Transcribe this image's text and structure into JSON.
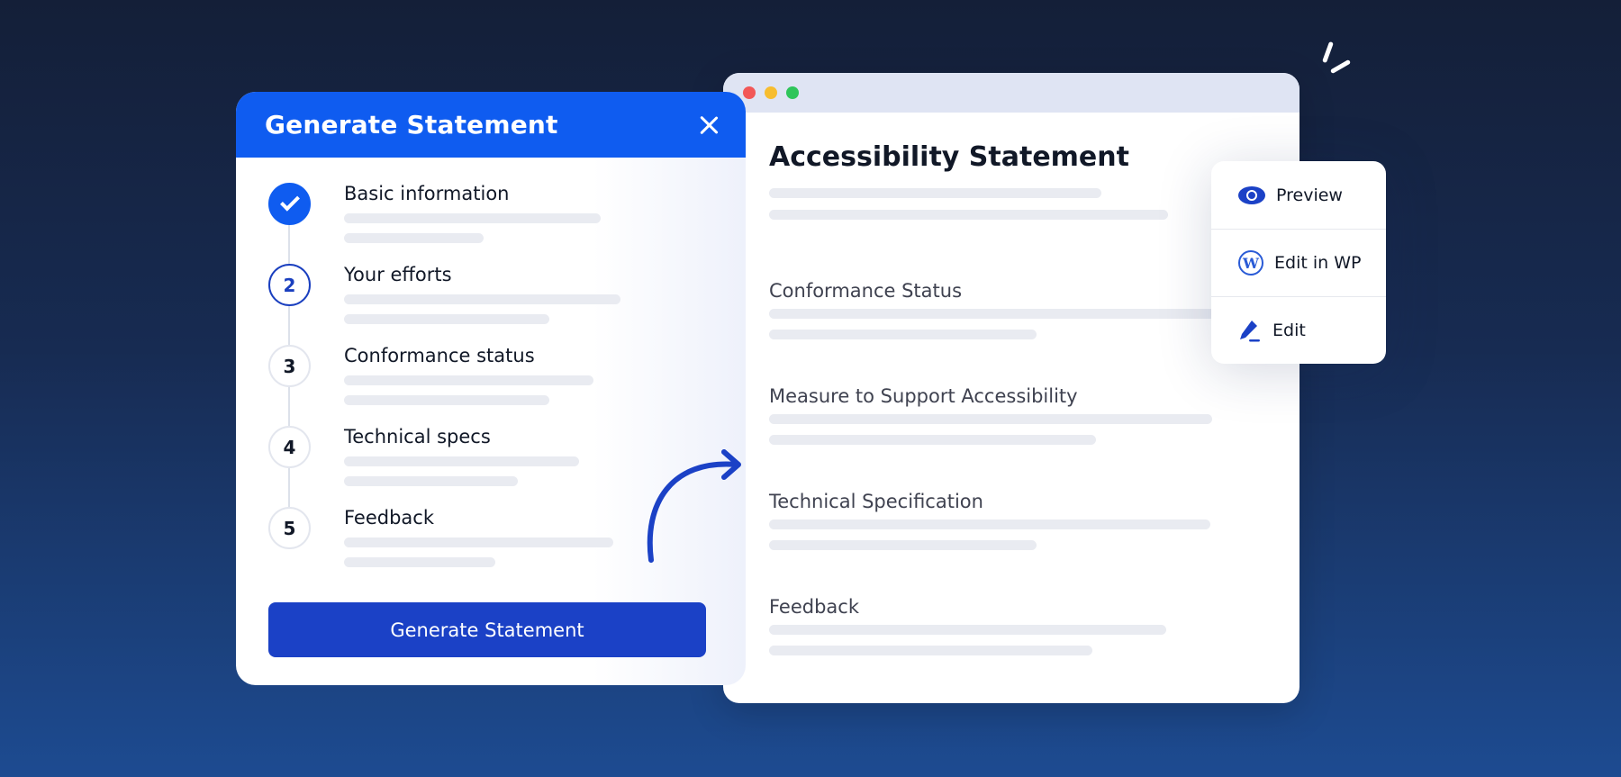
{
  "dialog": {
    "title": "Generate Statement",
    "steps": [
      {
        "number": "",
        "label": "Basic information",
        "state": "done"
      },
      {
        "number": "2",
        "label": "Your efforts",
        "state": "active"
      },
      {
        "number": "3",
        "label": "Conformance status",
        "state": "pending"
      },
      {
        "number": "4",
        "label": "Technical specs",
        "state": "pending"
      },
      {
        "number": "5",
        "label": "Feedback",
        "state": "pending"
      }
    ],
    "button_label": "Generate Statement"
  },
  "document": {
    "title": "Accessibility Statement",
    "sections": [
      "Conformance Status",
      "Measure to Support Accessibility",
      "Technical Specification",
      "Feedback"
    ]
  },
  "menu": {
    "items": [
      {
        "label": "Preview",
        "icon": "eye-icon"
      },
      {
        "label": "Edit in WP",
        "icon": "wordpress-icon"
      },
      {
        "label": "Edit",
        "icon": "pencil-icon"
      }
    ]
  },
  "colors": {
    "primary_blue": "#0f5cf0",
    "button_blue": "#1b41c6",
    "background_top": "#141f38",
    "background_bottom": "#1d4b91"
  }
}
